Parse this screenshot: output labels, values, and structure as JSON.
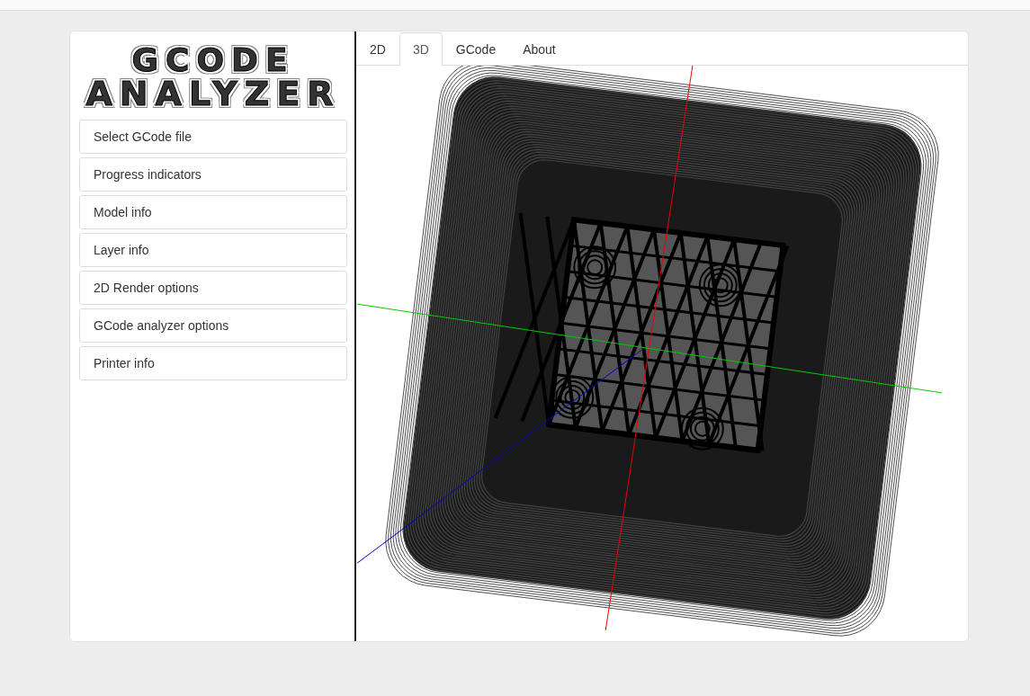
{
  "logo": {
    "line_1": "GCODE",
    "line_2": "ANALYZER"
  },
  "sidebar": {
    "items": [
      {
        "label": "Select GCode file"
      },
      {
        "label": "Progress indicators"
      },
      {
        "label": "Model info"
      },
      {
        "label": "Layer info"
      },
      {
        "label": "2D Render options"
      },
      {
        "label": "GCode analyzer options"
      },
      {
        "label": "Printer info"
      }
    ]
  },
  "tabs": [
    {
      "label": "2D",
      "selected": false
    },
    {
      "label": "3D",
      "selected": true
    },
    {
      "label": "GCode",
      "selected": false
    },
    {
      "label": "About",
      "selected": false
    }
  ]
}
